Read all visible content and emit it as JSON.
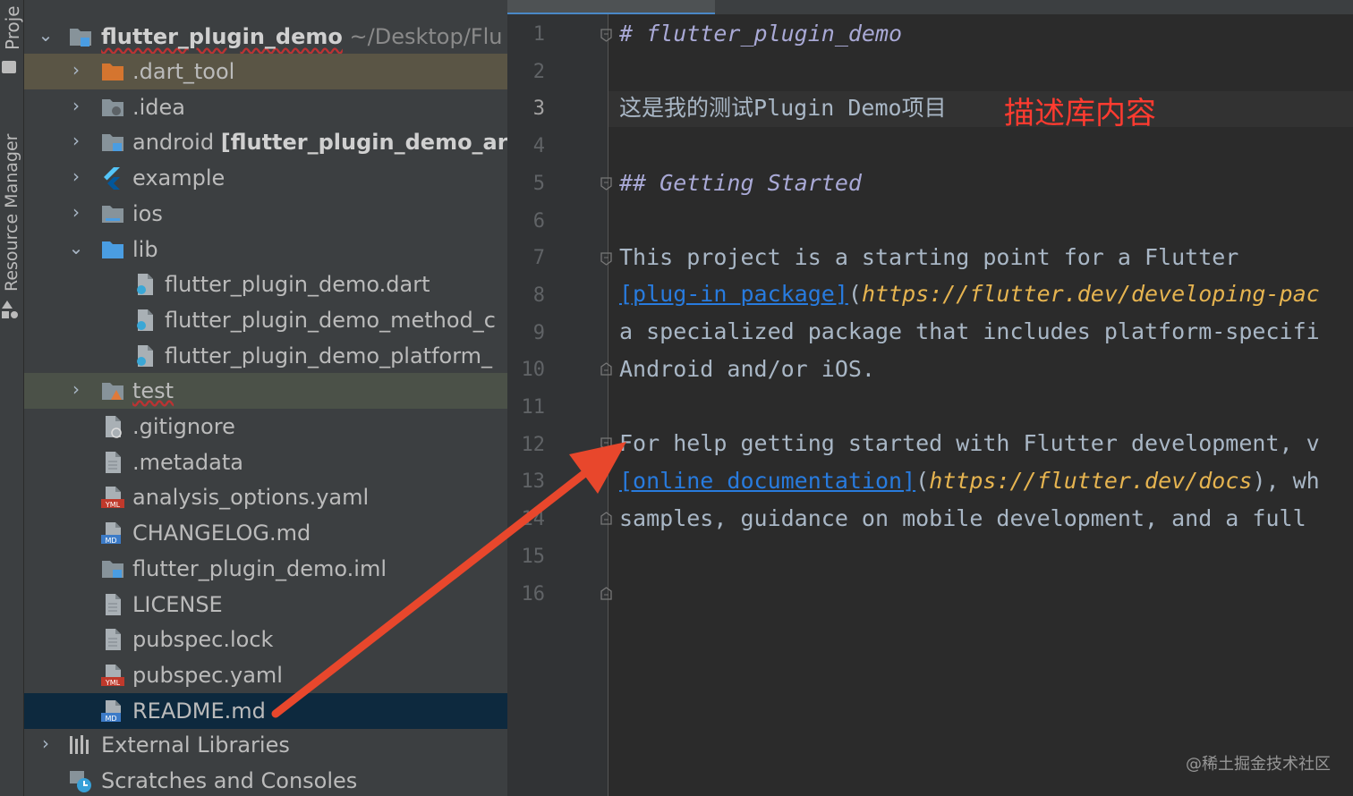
{
  "toolstrip": {
    "project_tab": "Proje",
    "resource_tab": "Resource Manager"
  },
  "project_tree": {
    "root": {
      "name": "flutter_plugin_demo",
      "path": "~/Desktop/Flu"
    },
    "items": [
      {
        "label": ".dart_tool",
        "icon": "folder-orange-icon",
        "chevron": "›"
      },
      {
        "label": ".idea",
        "icon": "folder-settings-icon",
        "chevron": "›"
      },
      {
        "label": "android",
        "bold_suffix": "[flutter_plugin_demo_ar",
        "icon": "folder-android-icon",
        "chevron": "›"
      },
      {
        "label": "example",
        "icon": "flutter-icon",
        "chevron": "›"
      },
      {
        "label": "ios",
        "icon": "folder-ios-icon",
        "chevron": "›"
      },
      {
        "label": "lib",
        "icon": "folder-icon",
        "chevron": "⌄"
      },
      {
        "label": "flutter_plugin_demo.dart",
        "icon": "dart-file-icon"
      },
      {
        "label": "flutter_plugin_demo_method_c",
        "icon": "dart-file-icon"
      },
      {
        "label": "flutter_plugin_demo_platform_",
        "icon": "dart-file-icon"
      },
      {
        "label": "test",
        "icon": "folder-test-icon",
        "chevron": "›"
      },
      {
        "label": ".gitignore",
        "icon": "gitignore-file-icon"
      },
      {
        "label": ".metadata",
        "icon": "text-file-icon"
      },
      {
        "label": "analysis_options.yaml",
        "icon": "yaml-file-icon"
      },
      {
        "label": "CHANGELOG.md",
        "icon": "markdown-file-icon"
      },
      {
        "label": "flutter_plugin_demo.iml",
        "icon": "iml-file-icon"
      },
      {
        "label": "LICENSE",
        "icon": "text-file-icon"
      },
      {
        "label": "pubspec.lock",
        "icon": "text-file-icon"
      },
      {
        "label": "pubspec.yaml",
        "icon": "yaml-file-icon"
      },
      {
        "label": "README.md",
        "icon": "markdown-file-icon"
      }
    ],
    "external_libraries": "External Libraries",
    "scratches": "Scratches and Consoles"
  },
  "editor": {
    "line_numbers": [
      "1",
      "2",
      "3",
      "4",
      "5",
      "6",
      "7",
      "8",
      "9",
      "10",
      "11",
      "12",
      "13",
      "14",
      "15",
      "16"
    ],
    "current_line": "3",
    "lines": {
      "l1": "# flutter_plugin_demo",
      "l3": "这是我的测试Plugin Demo项目",
      "l5": "## Getting Started",
      "l7": "This project is a starting point for a Flutter",
      "l8_link": "[plug-in package]",
      "l8_open": "(",
      "l8_url": "https://flutter.dev/developing-pac",
      "l9": "a specialized package that includes platform-specifi",
      "l10": "Android and/or iOS.",
      "l12": "For help getting started with Flutter development, v",
      "l13_link": "[online documentation]",
      "l13_open": "(",
      "l13_url": "https://flutter.dev/docs",
      "l13_close": "), wh",
      "l14": "samples, guidance on mobile development, and a full"
    },
    "annotation": "描述库内容",
    "watermark": "@稀土掘金技术社区"
  },
  "colors": {
    "annotation": "#ff3b30",
    "arrow": "#e8472c",
    "link": "#287bde",
    "url": "#e6b450"
  }
}
